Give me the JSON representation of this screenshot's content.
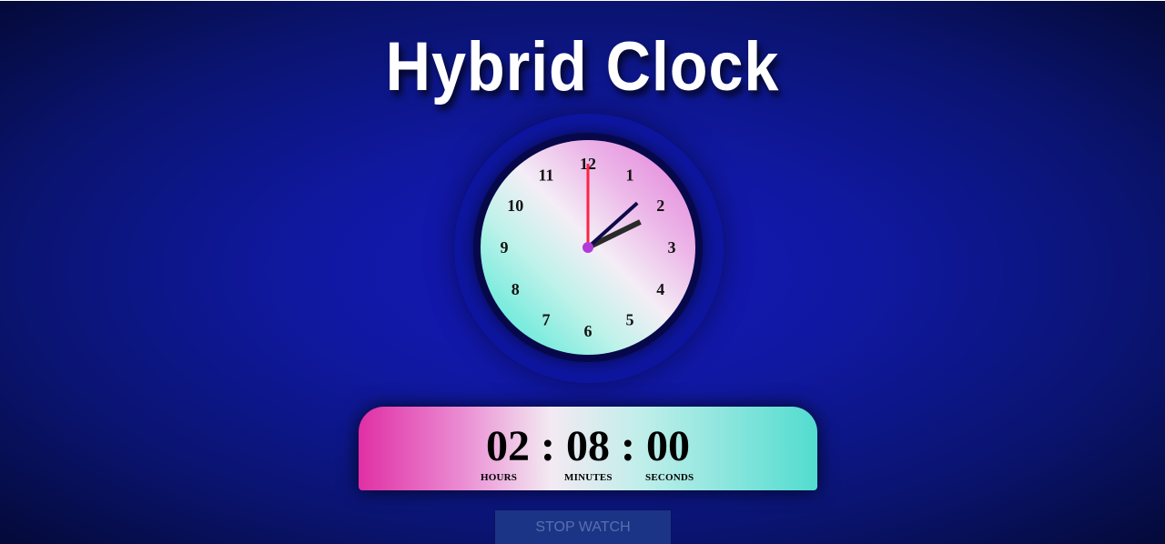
{
  "page": {
    "title": "Hybrid Clock"
  },
  "analog_clock": {
    "numbers": [
      "12",
      "1",
      "2",
      "3",
      "4",
      "5",
      "6",
      "7",
      "8",
      "9",
      "10",
      "11"
    ],
    "time": {
      "hours": 2,
      "minutes": 8,
      "seconds": 0
    },
    "colors": {
      "hour_hand": "#2a2a2a",
      "minute_hand": "#0c0a4a",
      "second_hand": "#ff2244",
      "center_dot": "#b23ad8"
    }
  },
  "digital_clock": {
    "hours": "02",
    "minutes": "08",
    "seconds": "00",
    "separator": ":",
    "hours_label": "HOURS",
    "minutes_label": "MINUTES",
    "seconds_label": "SECONDS"
  },
  "buttons": {
    "stopwatch_label": "STOP WATCH"
  }
}
